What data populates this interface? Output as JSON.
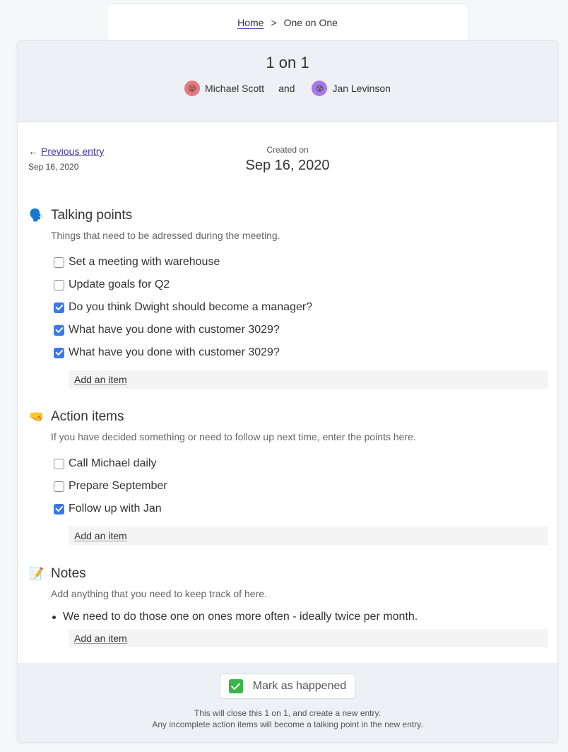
{
  "breadcrumb": {
    "home": "Home",
    "separator": ">",
    "current": "One on One"
  },
  "header": {
    "title": "1 on 1",
    "person1": {
      "name": "Michael Scott",
      "avatar_emoji": "😝"
    },
    "joiner": "and",
    "person2": {
      "name": "Jan Levinson",
      "avatar_emoji": "😵"
    }
  },
  "entry": {
    "prev_arrow": "←",
    "prev_label": "Previous entry",
    "prev_date": "Sep 16, 2020",
    "created_label": "Created on",
    "created_date": "Sep 16, 2020"
  },
  "talking_points": {
    "icon": "🗣️",
    "title": "Talking points",
    "description": "Things that need to be adressed during the meeting.",
    "items": [
      {
        "label": "Set a meeting with warehouse",
        "checked": false
      },
      {
        "label": "Update goals for Q2",
        "checked": false
      },
      {
        "label": "Do you think Dwight should become a manager?",
        "checked": true
      },
      {
        "label": "What have you done with customer 3029?",
        "checked": true
      },
      {
        "label": "What have you done with customer 3029?",
        "checked": true
      }
    ],
    "add_label": "Add an item"
  },
  "action_items": {
    "icon": "🤜",
    "title": "Action items",
    "description": "If you have decided something or need to follow up next time, enter the points here.",
    "items": [
      {
        "label": "Call Michael daily",
        "checked": false
      },
      {
        "label": "Prepare September",
        "checked": false
      },
      {
        "label": "Follow up with Jan",
        "checked": true
      }
    ],
    "add_label": "Add an item"
  },
  "notes": {
    "icon": "📝",
    "title": "Notes",
    "description": "Add anything that you need to keep track of here.",
    "items": [
      "We need to do those one on ones more often - ideally twice per month."
    ],
    "add_label": "Add an item"
  },
  "footer": {
    "button_label": "Mark as happened",
    "note_line1": "This will close this 1 on 1, and create a new entry.",
    "note_line2": "Any incomplete action items will become a talking point in the new entry."
  },
  "colors": {
    "accent": "#4938a8",
    "checkbox": "#3a78e8",
    "header_bg": "#edf0f4"
  }
}
